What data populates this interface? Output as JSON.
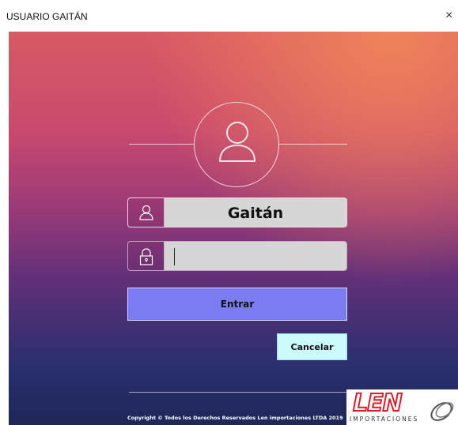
{
  "window": {
    "title": "USUARIO GAITÁN",
    "close_glyph": "×"
  },
  "login": {
    "avatar_icon": "user-icon",
    "username_icon": "user-icon",
    "username_value": "Gaitán",
    "password_icon": "lock-icon",
    "password_value": "",
    "enter_label": "Entrar",
    "cancel_label": "Cancelar"
  },
  "footer": {
    "copyright": "Copyright © Todos los Derechos Reservados Len importaciones LTDA 2019"
  },
  "logo": {
    "brand": "LEN",
    "subtitle": "IMPORTACIONES"
  },
  "colors": {
    "enter_button": "#7b7cf2",
    "cancel_button": "#ccfbfb",
    "brand_red": "#d81e2c"
  }
}
